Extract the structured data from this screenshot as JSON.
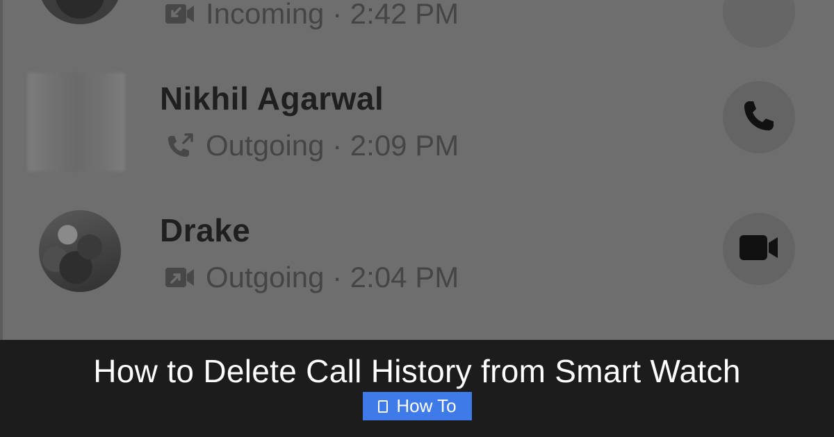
{
  "calls": [
    {
      "name": "",
      "direction": "Incoming",
      "time": "2:42 PM",
      "call_type_icon": "video-incoming-icon",
      "action_icon": "video-call-icon",
      "avatar": "photo"
    },
    {
      "name": "Nikhil Agarwal",
      "direction": "Outgoing",
      "time": "2:09 PM",
      "call_type_icon": "phone-outgoing-icon",
      "action_icon": "phone-icon",
      "avatar": "blurred"
    },
    {
      "name": "Drake",
      "direction": "Outgoing",
      "time": "2:04 PM",
      "call_type_icon": "video-outgoing-icon",
      "action_icon": "video-call-icon",
      "avatar": "photo"
    }
  ],
  "meta_separator": " · ",
  "banner": {
    "title": "How to Delete Call History from Smart Watch",
    "category_label": "How To",
    "category_icon": "document-icon",
    "category_color": "#3f7be8"
  }
}
